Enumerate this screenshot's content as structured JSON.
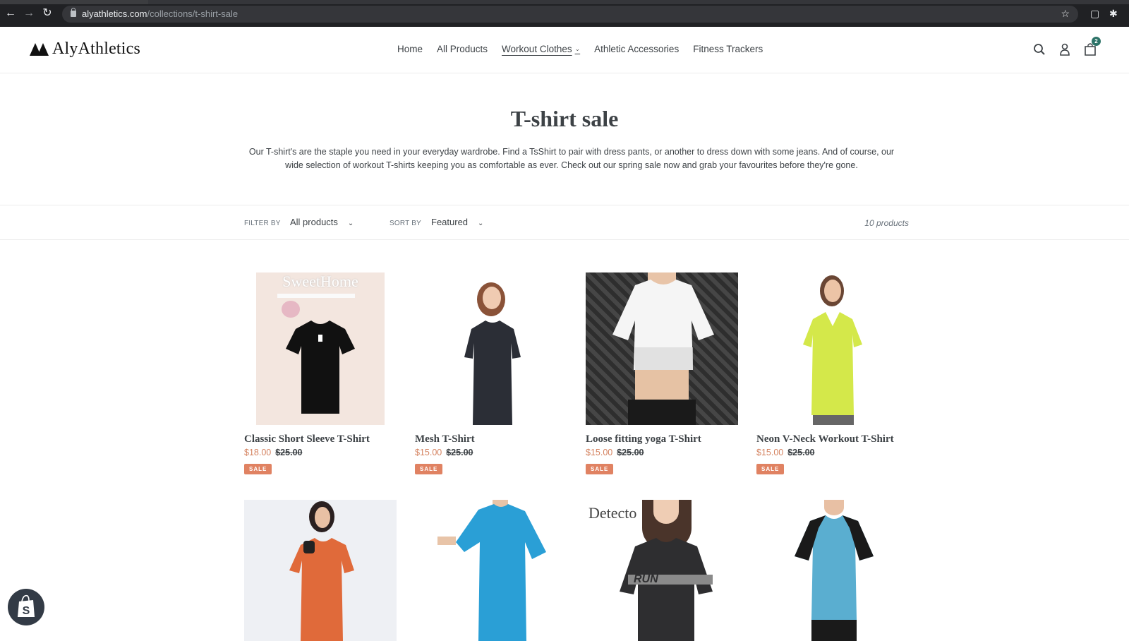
{
  "browser": {
    "url_host": "alyathletics.com",
    "url_path": "/collections/t-shirt-sale",
    "icons": [
      "back-icon",
      "forward-icon",
      "reload-icon",
      "lock-icon",
      "star-icon",
      "cast-icon",
      "extensions-icon"
    ]
  },
  "header": {
    "logo_text": "AlyAthletics",
    "nav": [
      {
        "label": "Home",
        "active": false
      },
      {
        "label": "All Products",
        "active": false
      },
      {
        "label": "Workout Clothes",
        "active": true,
        "dropdown": true
      },
      {
        "label": "Athletic Accessories",
        "active": false
      },
      {
        "label": "Fitness Trackers",
        "active": false
      }
    ],
    "cart_count": "2"
  },
  "collection": {
    "title": "T-shirt sale",
    "description": "Our T-shirt's are the staple you need in your everyday wardrobe. Find a TsShirt to pair with dress pants, or another to dress down with some jeans. And of course, our wide selection of workout T-shirts keeping you as comfortable as ever. Check out our spring sale now and grab your favourites before they're gone."
  },
  "filters": {
    "filter_label": "FILTER BY",
    "filter_value": "All products",
    "sort_label": "SORT BY",
    "sort_value": "Featured",
    "count": "10 products"
  },
  "products": [
    {
      "name": "Classic Short Sleeve T-Shirt",
      "price": "$18.00",
      "compare_price": "$25.00",
      "badge": "SALE",
      "shirt_color": "#111111",
      "bg": "#f3e6df"
    },
    {
      "name": "Mesh T-Shirt",
      "price": "$15.00",
      "compare_price": "$25.00",
      "badge": "SALE",
      "shirt_color": "#2b2e36",
      "bg": "#ffffff"
    },
    {
      "name": "Loose fitting yoga T-Shirt",
      "price": "$15.00",
      "compare_price": "$25.00",
      "badge": "SALE",
      "shirt_color": "#f5f5f5",
      "bg": "#3a3a3a"
    },
    {
      "name": "Neon V-Neck Workout T-Shirt",
      "price": "$15.00",
      "compare_price": "$25.00",
      "badge": "SALE",
      "shirt_color": "#d4e84a",
      "bg": "#ffffff"
    },
    {
      "name": "",
      "shirt_color": "#e06a3a",
      "bg": "#eef0f4"
    },
    {
      "name": "",
      "shirt_color": "#2a9fd6",
      "bg": "#ffffff"
    },
    {
      "name": "",
      "shirt_color": "#2e2e30",
      "bg": "#ffffff",
      "overlay_text": "Detecto",
      "shirt_text": "RUN"
    },
    {
      "name": "",
      "shirt_color": "#5aaed0",
      "bg": "#ffffff"
    }
  ],
  "thumb_texts": {
    "sweet_home": "SweetHome"
  }
}
